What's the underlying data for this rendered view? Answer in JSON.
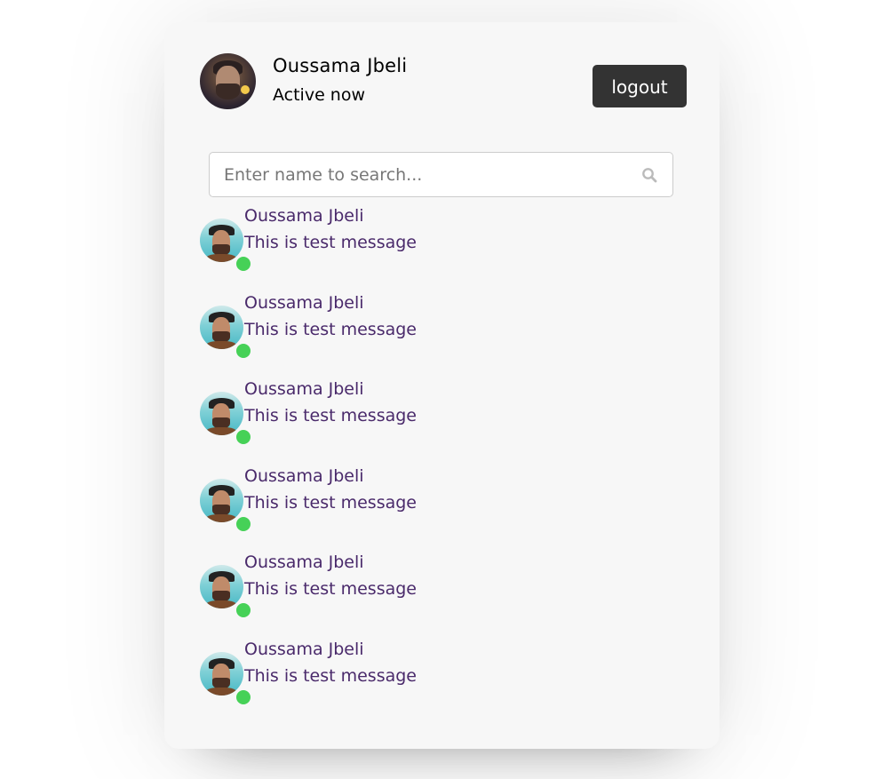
{
  "header": {
    "user_name": "Oussama Jbeli",
    "status": "Active now",
    "logout_label": "logout",
    "avatar_icon": "user-avatar"
  },
  "search": {
    "placeholder": "Enter name to search...",
    "value": "",
    "icon": "search-icon"
  },
  "users": [
    {
      "name": "Oussama Jbeli",
      "message": "This is test message",
      "online": true
    },
    {
      "name": "Oussama Jbeli",
      "message": "This is test message",
      "online": true
    },
    {
      "name": "Oussama Jbeli",
      "message": "This is test message",
      "online": true
    },
    {
      "name": "Oussama Jbeli",
      "message": "This is test message",
      "online": true
    },
    {
      "name": "Oussama Jbeli",
      "message": "This is test message",
      "online": true
    },
    {
      "name": "Oussama Jbeli",
      "message": "This is test message",
      "online": true
    }
  ],
  "colors": {
    "logout_bg": "#333333",
    "online": "#46d157",
    "list_text": "#4a2a6b",
    "panel_bg": "#f7f7f7"
  }
}
